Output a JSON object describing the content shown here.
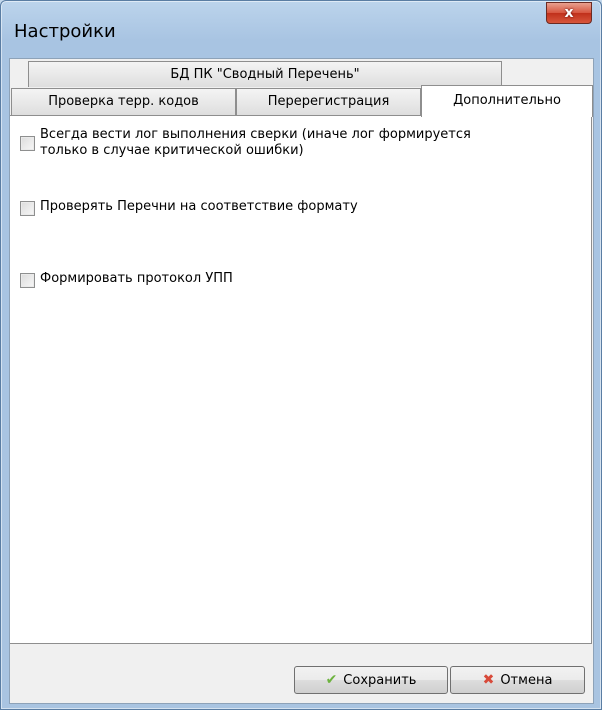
{
  "window": {
    "title": "Настройки",
    "close_glyph": "x"
  },
  "tabs": {
    "upper": "БД ПК \"Сводный Перечень\"",
    "row": [
      "Проверка терр. кодов",
      "Перерегистрация",
      "Дополнительно"
    ]
  },
  "options": [
    {
      "label": "Всегда вести лог выполнения сверки (иначе лог формируется\nтолько в случае критической ошибки)",
      "checked": false
    },
    {
      "label": "Проверять Перечни на соответствие формату",
      "checked": false
    },
    {
      "label": "Формировать протокол УПП",
      "checked": false
    }
  ],
  "buttons": {
    "save_label": "Сохранить",
    "save_icon": "check-icon",
    "cancel_label": "Отмена",
    "cancel_icon": "cross-icon"
  }
}
